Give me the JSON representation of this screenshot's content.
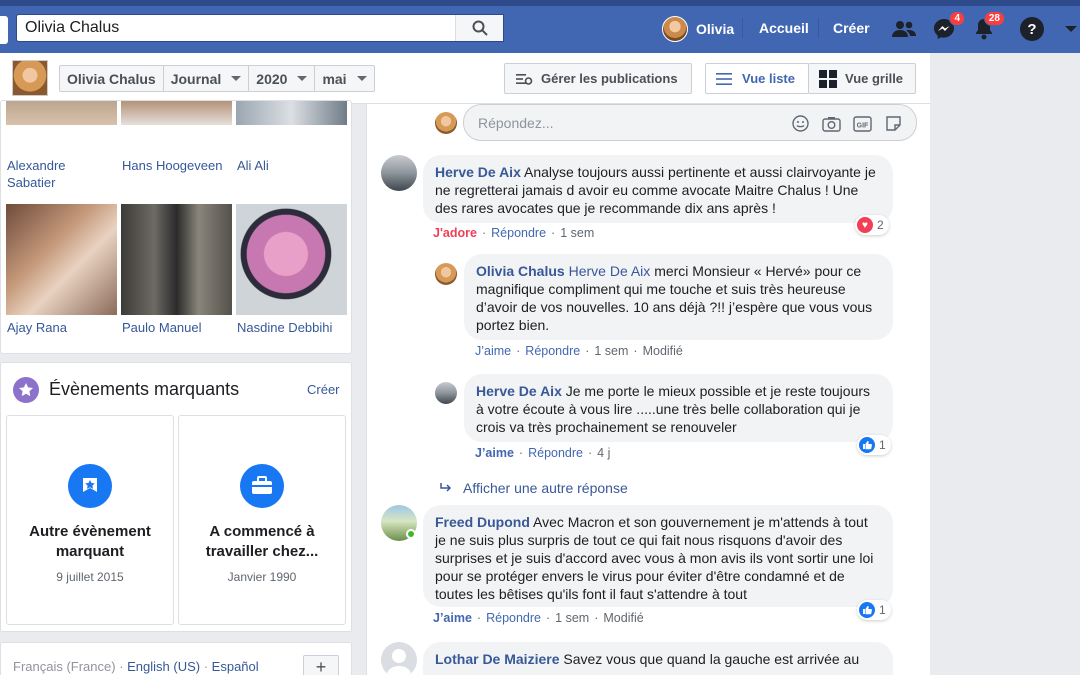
{
  "topbar": {
    "search_value": "Olivia Chalus",
    "user_name": "Olivia",
    "home_label": "Accueil",
    "create_label": "Créer",
    "messages_badge": "4",
    "notifications_badge": "28",
    "help_glyph": "?",
    "accent_color": "#4267b2"
  },
  "subheader": {
    "crumbs": [
      "Olivia Chalus",
      "Journal",
      "2020",
      "mai"
    ],
    "manage_posts": "Gérer les publications",
    "list_view": "Vue liste",
    "grid_view": "Vue grille"
  },
  "friends": [
    {
      "name": "Alexandre Sabatier"
    },
    {
      "name": "Hans Hoogeveen"
    },
    {
      "name": "Ali Ali"
    },
    {
      "name": "Ajay Rana"
    },
    {
      "name": "Paulo Manuel"
    },
    {
      "name": "Nasdine Debbihi"
    }
  ],
  "events": {
    "title": "Évènements marquants",
    "create": "Créer",
    "items": [
      {
        "title": "Autre évènement marquant",
        "date": "9 juillet 2015",
        "icon": "star-icon"
      },
      {
        "title": "A commencé à travailler chez...",
        "date": "Janvier 1990",
        "icon": "briefcase-icon"
      }
    ]
  },
  "footer": {
    "languages": [
      "Français (France)",
      "English (US)",
      "Español"
    ],
    "separator": " · ",
    "add": "+"
  },
  "comments": {
    "reply_placeholder": "Répondez...",
    "items": [
      {
        "author": "Herve De Aix",
        "text": "Analyse toujours aussi pertinente et aussi clairvoyante je ne regretterai jamais d avoir eu comme avocate Maitre Chalus ! Une des rares avocates que je recommande dix ans après !",
        "reaction_label": "J'adore",
        "reply": "Répondre",
        "time": "1 sem",
        "reaction_count": "2"
      },
      {
        "author": "Olivia Chalus",
        "mention": "Herve De Aix",
        "text": "merci Monsieur « Hervé» pour ce magnifique compliment qui me touche et suis très heureuse d’avoir de vos nouvelles. 10 ans déjà ?!! j’espère que vous vous portez bien.",
        "like": "J’aime",
        "reply": "Répondre",
        "time": "1 sem",
        "edited": "Modifié"
      },
      {
        "author": "Herve De Aix",
        "text": "Je me porte le mieux possible et je reste toujours à votre écoute à vous lire .....une très belle collaboration qui je crois va très prochainement se renouveler",
        "like": "J’aime",
        "reply": "Répondre",
        "time": "4 j",
        "reaction_count": "1"
      },
      {
        "more": "Afficher une autre réponse"
      },
      {
        "author": "Freed Dupond",
        "text": "Avec Macron et son gouvernement je m'attends à tout je ne suis plus surpris de tout ce qui fait nous risquons d'avoir des surprises et je suis d'accord avec vous à mon avis ils vont sortir une loi pour se protéger envers le virus pour éviter d'être condamné et de toutes les bêtises qu'ils font il faut s'attendre à tout",
        "like": "J’aime",
        "reply": "Répondre",
        "time": "1 sem",
        "edited": "Modifié",
        "reaction_count": "1"
      },
      {
        "author": "Lothar De Maiziere",
        "text": "Savez vous que quand la gauche est arrivée au"
      }
    ]
  }
}
